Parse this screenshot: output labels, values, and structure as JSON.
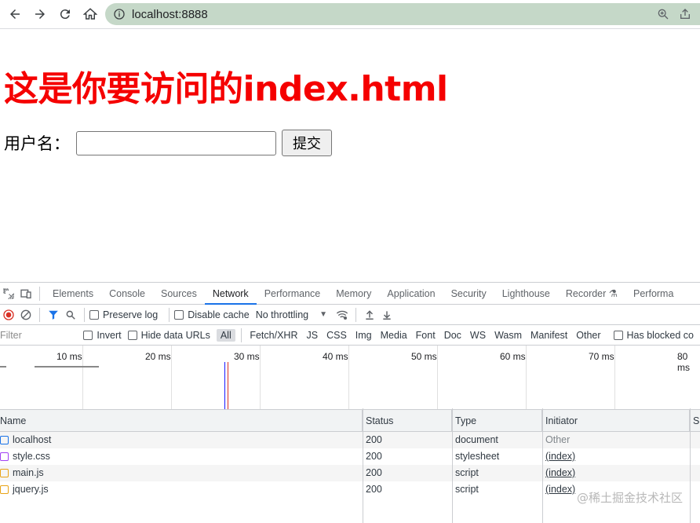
{
  "browser": {
    "url": "localhost:8888"
  },
  "page": {
    "heading": "这是你要访问的index.html",
    "form_label": "用户名：",
    "input_value": "",
    "submit_label": "提交"
  },
  "devtools": {
    "tabs": [
      "Elements",
      "Console",
      "Sources",
      "Network",
      "Performance",
      "Memory",
      "Application",
      "Security",
      "Lighthouse",
      "Recorder",
      "Performa"
    ],
    "active_tab": "Network",
    "toolbar": {
      "preserve_log": "Preserve log",
      "disable_cache": "Disable cache",
      "throttling": "No throttling"
    },
    "filter_row": {
      "filter_placeholder": "Filter",
      "invert": "Invert",
      "hide_data_urls": "Hide data URLs",
      "types": [
        "All",
        "Fetch/XHR",
        "JS",
        "CSS",
        "Img",
        "Media",
        "Font",
        "Doc",
        "WS",
        "Wasm",
        "Manifest",
        "Other"
      ],
      "active_type": "All",
      "has_blocked": "Has blocked co"
    },
    "timeline": {
      "ticks": [
        "10 ms",
        "20 ms",
        "30 ms",
        "40 ms",
        "50 ms",
        "60 ms",
        "70 ms",
        "80 ms"
      ]
    },
    "table": {
      "columns": [
        "Name",
        "Status",
        "Type",
        "Initiator",
        "Si"
      ],
      "rows": [
        {
          "name": "localhost",
          "status": "200",
          "type": "document",
          "initiator": "Other",
          "icon": "document-icon"
        },
        {
          "name": "style.css",
          "status": "200",
          "type": "stylesheet",
          "initiator": "(index)",
          "icon": "stylesheet-icon"
        },
        {
          "name": "main.js",
          "status": "200",
          "type": "script",
          "initiator": "(index)",
          "icon": "script-icon"
        },
        {
          "name": "jquery.js",
          "status": "200",
          "type": "script",
          "initiator": "(index)",
          "icon": "script-icon"
        }
      ]
    }
  },
  "watermark": "@稀土掘金技术社区",
  "colors": {
    "heading": "#f50000",
    "accent": "#1a73e8",
    "record": "#d93025",
    "omnibox": "#c5d8c8"
  }
}
